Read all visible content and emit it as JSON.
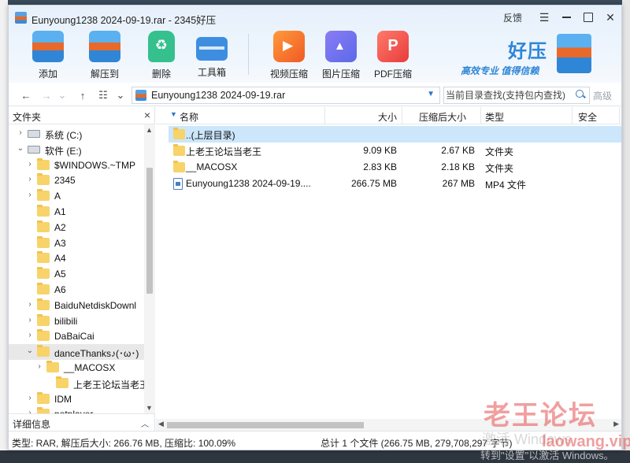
{
  "window": {
    "title": "Eunyoung1238 2024-09-19.rar - 2345好压",
    "feedback_label": "反馈",
    "menu_glyph": "☰",
    "close_glyph": "✕"
  },
  "toolbar": {
    "add_label": "添加",
    "extract_label": "解压到",
    "delete_label": "删除",
    "tools_label": "工具箱",
    "video_label": "视频压缩",
    "image_label": "图片压缩",
    "pdf_label": "PDF压缩"
  },
  "brand": {
    "name": "好压",
    "slogan": "高效专业  值得信赖",
    "accent": "#2f86d6"
  },
  "nav": {
    "back": "←",
    "forward": "→",
    "up": "↑",
    "view": "☷",
    "dropdown": "⌄"
  },
  "address": {
    "path": "Eunyoung1238 2024-09-19.rar"
  },
  "search": {
    "placeholder": "当前目录查找(支持包内查找)",
    "advanced_label": "高级"
  },
  "sidebar": {
    "title": "文件夹",
    "close": "×",
    "details_label": "详细信息",
    "items": [
      {
        "label": "系统 (C:)",
        "type": "drive",
        "expander": "›"
      },
      {
        "label": "软件 (E:)",
        "type": "drive",
        "expander": "⌄"
      },
      {
        "label": "$WINDOWS.~TMP",
        "type": "folder",
        "expander": "›"
      },
      {
        "label": "2345",
        "type": "folder",
        "expander": "›"
      },
      {
        "label": "A",
        "type": "folder",
        "expander": "›"
      },
      {
        "label": "A1",
        "type": "folder",
        "expander": ""
      },
      {
        "label": "A2",
        "type": "folder",
        "expander": ""
      },
      {
        "label": "A3",
        "type": "folder",
        "expander": ""
      },
      {
        "label": "A4",
        "type": "folder",
        "expander": ""
      },
      {
        "label": "A5",
        "type": "folder",
        "expander": ""
      },
      {
        "label": "A6",
        "type": "folder",
        "expander": ""
      },
      {
        "label": "BaiduNetdiskDownl",
        "type": "folder",
        "expander": "›"
      },
      {
        "label": "bilibili",
        "type": "folder",
        "expander": "›"
      },
      {
        "label": "DaBaiCai",
        "type": "folder",
        "expander": "›"
      },
      {
        "label": "danceThanks♪(･ω･)",
        "type": "folder",
        "expander": "⌄"
      },
      {
        "label": "__MACOSX",
        "type": "folder",
        "expander": "›"
      },
      {
        "label": "上老王论坛当老王",
        "type": "folder",
        "expander": ""
      },
      {
        "label": "IDM",
        "type": "folder",
        "expander": "›"
      },
      {
        "label": "potplayer",
        "type": "folder",
        "expander": "›"
      }
    ]
  },
  "filelist": {
    "columns": {
      "name": "名称",
      "size": "大小",
      "packed": "压缩后大小",
      "type": "类型",
      "security": "安全"
    },
    "rows": [
      {
        "name": "..(上层目录)",
        "size": "",
        "packed": "",
        "type": "",
        "kind": "folder"
      },
      {
        "name": "上老王论坛当老王",
        "size": "9.09 KB",
        "packed": "2.67 KB",
        "type": "文件夹",
        "kind": "folder"
      },
      {
        "name": "__MACOSX",
        "size": "2.83 KB",
        "packed": "2.18 KB",
        "type": "文件夹",
        "kind": "folder"
      },
      {
        "name": "Eunyoung1238 2024-09-19....",
        "size": "266.75 MB",
        "packed": "267 MB",
        "type": "MP4 文件",
        "kind": "file"
      }
    ]
  },
  "status": {
    "left": "类型: RAR, 解压后大小: 266.76 MB, 压缩比: 100.09%",
    "right": "总计 1 个文件 (266.75 MB, 279,708,297 字节)"
  },
  "watermarks": {
    "site": "老王论坛",
    "url": "laowang.vip",
    "activate": "激活 Windows",
    "activate_hint": "转到\"设置\"以激活 Windows。"
  }
}
